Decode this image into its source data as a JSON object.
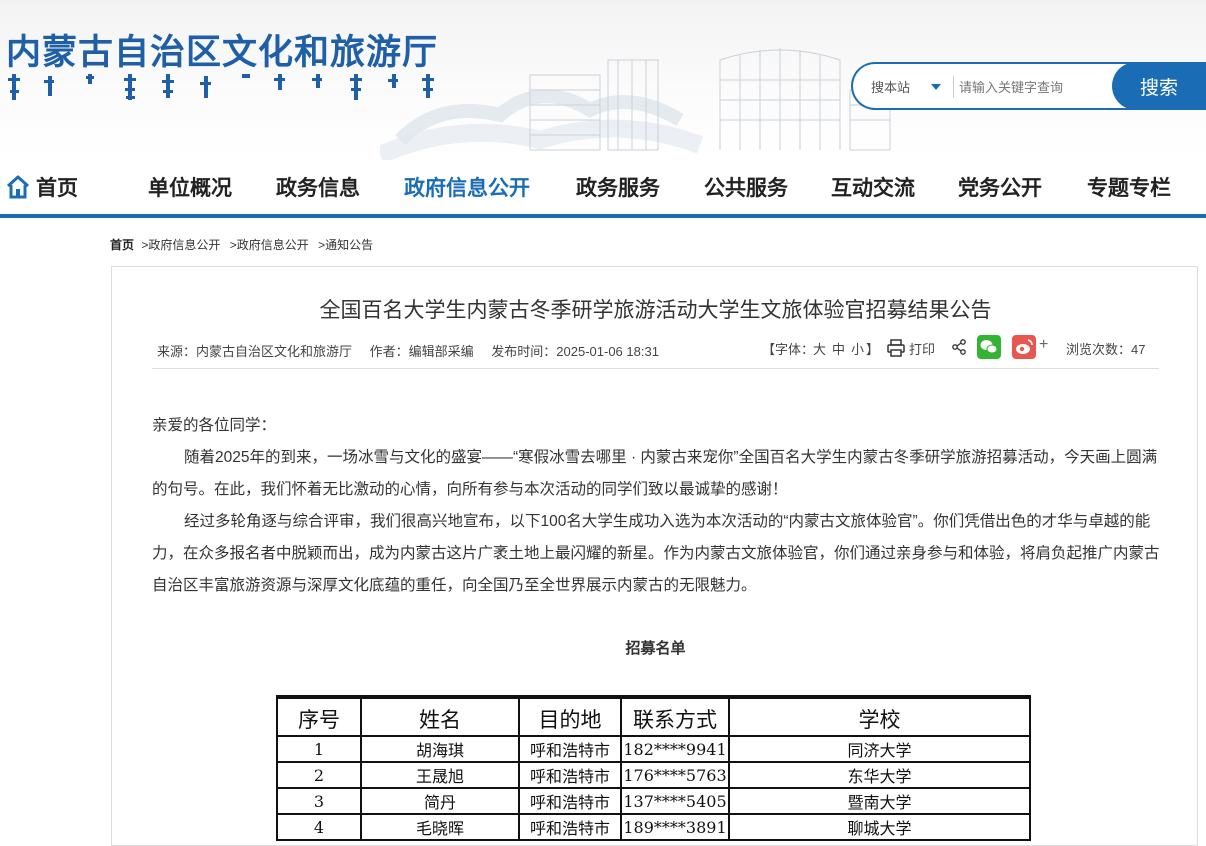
{
  "header": {
    "site_title": "内蒙古自治区文化和旅游厅",
    "search": {
      "scope_label": "搜本站",
      "placeholder": "请输入关键字查询",
      "button_label": "搜索"
    }
  },
  "nav": [
    {
      "label": "首页"
    },
    {
      "label": "单位概况"
    },
    {
      "label": "政务信息"
    },
    {
      "label": "政府信息公开"
    },
    {
      "label": "政务服务"
    },
    {
      "label": "公共服务"
    },
    {
      "label": "互动交流"
    },
    {
      "label": "党务公开"
    },
    {
      "label": "专题专栏"
    }
  ],
  "colors": {
    "brand": "#1a6db5",
    "title": "#1e5fa8",
    "wechat": "#33b435",
    "weibo": "#e8574f"
  },
  "breadcrumb": {
    "home": "首页",
    "items": [
      ">政府信息公开",
      ">政府信息公开",
      ">通知公告"
    ]
  },
  "article": {
    "title": "全国百名大学生内蒙古冬季研学旅游活动大学生文旅体验官招募结果公告",
    "meta": {
      "source": "来源：内蒙古自治区文化和旅游厅",
      "author": "作者：编辑部采编",
      "time": "发布时间：2025-01-06 18:31",
      "font_size_label": "【字体：",
      "font_large": "大",
      "font_medium": "中",
      "font_small": "小",
      "font_size_end": "】",
      "print_label": "打印",
      "plus": "+",
      "views": "浏览次数：47"
    },
    "greeting": "亲爱的各位同学：",
    "paragraphs": [
      "随着2025年的到来，一场冰雪与文化的盛宴——“寒假冰雪去哪里 · 内蒙古来宠你”全国百名大学生内蒙古冬季研学旅游招募活动，今天画上圆满的句号。在此，我们怀着无比激动的心情，向所有参与本次活动的同学们致以最诚挚的感谢！",
      "经过多轮角逐与综合评审，我们很高兴地宣布，以下100名大学生成功入选为本次活动的“内蒙古文旅体验官”。你们凭借出色的才华与卓越的能力，在众多报名者中脱颖而出，成为内蒙古这片广袤土地上最闪耀的新星。作为内蒙古文旅体验官，你们通过亲身参与和体验，将肩负起推广内蒙古自治区丰富旅游资源与深厚文化底蕴的重任，向全国乃至全世界展示内蒙古的无限魅力。"
    ],
    "list_title": "招募名单"
  },
  "roster": {
    "headers": [
      "序号",
      "姓名",
      "目的地",
      "联系方式",
      "学校"
    ],
    "rows": [
      [
        "1",
        "胡海琪",
        "呼和浩特市",
        "182****9941",
        "同济大学"
      ],
      [
        "2",
        "王晟旭",
        "呼和浩特市",
        "176****5763",
        "东华大学"
      ],
      [
        "3",
        "简丹",
        "呼和浩特市",
        "137****5405",
        "暨南大学"
      ],
      [
        "4",
        "毛晓晖",
        "呼和浩特市",
        "189****3891",
        "聊城大学"
      ]
    ]
  }
}
